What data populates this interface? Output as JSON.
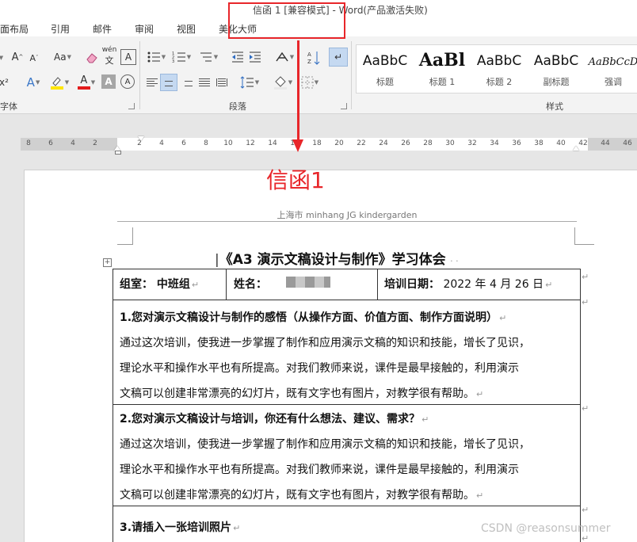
{
  "window": {
    "title": "信函 1 [兼容模式] - Word(产品激活失败)"
  },
  "ribbon_tabs": [
    "面布局",
    "引用",
    "邮件",
    "审阅",
    "视图",
    "美化大师"
  ],
  "ribbon": {
    "font_group_label": "字体",
    "paragraph_group_label": "段落",
    "styles_group_label": "样式",
    "font_buttons": {
      "grow_font": "A",
      "shrink_font": "A",
      "change_case": "Aa",
      "phonetic": "wén",
      "superscript": "x²",
      "text_effects": "A",
      "font_color": "A",
      "char_shading": "A",
      "enclose_char": "A"
    },
    "styles": [
      {
        "sample": "AaBbC",
        "name": "标题"
      },
      {
        "sample": "AaBl",
        "name": "标题 1"
      },
      {
        "sample": "AaBbC",
        "name": "标题 2"
      },
      {
        "sample": "AaBbC",
        "name": "副标题"
      },
      {
        "sample": "AaBbCcD",
        "name": "强调"
      }
    ]
  },
  "ruler": {
    "ticks": [
      "8",
      "6",
      "4",
      "2",
      "",
      "2",
      "4",
      "6",
      "8",
      "10",
      "12",
      "14",
      "16",
      "18",
      "20",
      "22",
      "24",
      "26",
      "28",
      "30",
      "32",
      "34",
      "36",
      "38",
      "40",
      "42",
      "44",
      "46"
    ]
  },
  "document": {
    "header": "上海市 minhang JG kindergarden",
    "title": "《A3 演示文稿设计与制作》学习体会",
    "info_row": {
      "group": "组室：  中班组",
      "name_label": "姓名：",
      "date_label": "培训日期：",
      "date_value": "2022 年 4 月 26 日"
    },
    "q1": {
      "heading": "1.您对演示文稿设计与制作的感悟（从操作方面、价值方面、制作方面说明）",
      "lines": [
        "通过这次培训，使我进一步掌握了制作和应用演示文稿的知识和技能，增长了见识，",
        "理论水平和操作水平也有所提高。对我们教师来说，课件是最早接触的，利用演示",
        "文稿可以创建非常漂亮的幻灯片，既有文字也有图片，对教学很有帮助。"
      ]
    },
    "q2": {
      "heading": "2.您对演示文稿设计与培训，你还有什么想法、建议、需求？",
      "lines": [
        "通过这次培训，使我进一步掌握了制作和应用演示文稿的知识和技能，增长了见识，",
        "理论水平和操作水平也有所提高。对我们教师来说，课件是最早接触的，利用演示",
        "文稿可以创建非常漂亮的幻灯片，既有文字也有图片，对教学很有帮助。"
      ]
    },
    "q3": {
      "heading": "3.请插入一张培训照片"
    }
  },
  "annotation": {
    "label": "信函1",
    "color": "#e8262a"
  },
  "watermark": "CSDN @reasonsummer"
}
